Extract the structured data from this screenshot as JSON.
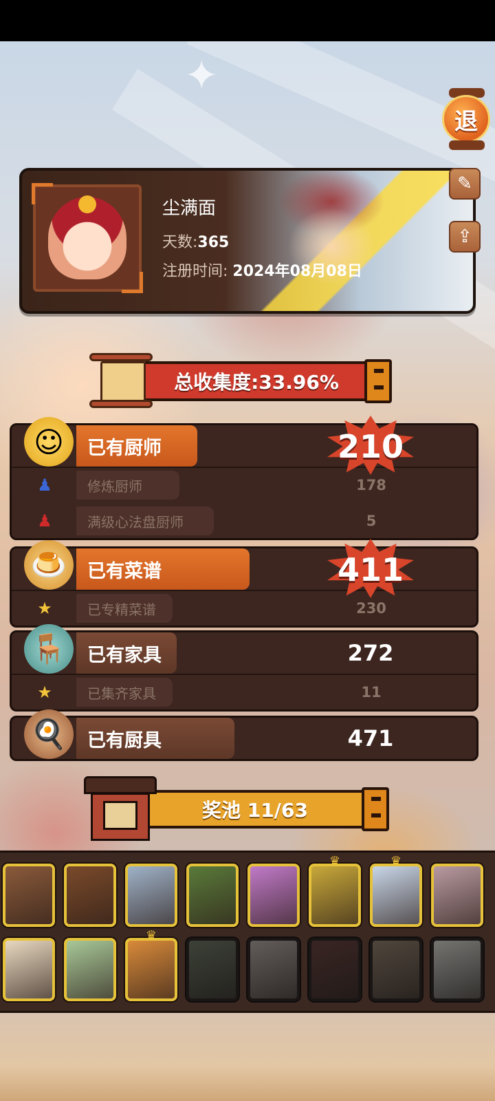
{
  "profile": {
    "name": "尘满面",
    "days_label": "天数:",
    "days_value": "365",
    "reg_label": "注册时间:",
    "reg_value": "2024年08月08日"
  },
  "buttons": {
    "exit": "退",
    "edit_icon": "edit-icon",
    "share_icon": "share-icon"
  },
  "collection": {
    "label": "总收集度:33.96%"
  },
  "stats": {
    "chefs": {
      "label": "已有厨师",
      "count": "210",
      "sub": [
        {
          "label": "修炼厨师",
          "count": "178",
          "icon": "blue-chef-icon"
        },
        {
          "label": "满级心法盘厨师",
          "count": "5",
          "icon": "red-chef-icon"
        }
      ]
    },
    "recipes": {
      "label": "已有菜谱",
      "count": "411",
      "sub": [
        {
          "label": "已专精菜谱",
          "count": "230",
          "icon": "star-icon"
        }
      ]
    },
    "furniture": {
      "label": "已有家具",
      "count": "272",
      "sub": [
        {
          "label": "已集齐家具",
          "count": "11",
          "icon": "star-icon"
        }
      ]
    },
    "utensils": {
      "label": "已有厨具",
      "count": "471"
    }
  },
  "prize_pool": {
    "label": "奖池   11/63",
    "cards": [
      {
        "unlocked": true,
        "crowned": false,
        "color": "#8a5a3a"
      },
      {
        "unlocked": true,
        "crowned": false,
        "color": "#7a4a2a"
      },
      {
        "unlocked": true,
        "crowned": false,
        "color": "#9fb2c8"
      },
      {
        "unlocked": true,
        "crowned": false,
        "color": "#5a7a3a"
      },
      {
        "unlocked": true,
        "crowned": false,
        "color": "#c07ac8"
      },
      {
        "unlocked": true,
        "crowned": true,
        "color": "#c8a83a"
      },
      {
        "unlocked": true,
        "crowned": true,
        "color": "#c8d6e8"
      },
      {
        "unlocked": true,
        "crowned": false,
        "color": "#b89aa0"
      },
      {
        "unlocked": true,
        "crowned": false,
        "color": "#e8d8c0"
      },
      {
        "unlocked": true,
        "crowned": false,
        "color": "#a8c898"
      },
      {
        "unlocked": true,
        "crowned": true,
        "color": "#d88a3a"
      },
      {
        "unlocked": false,
        "crowned": false,
        "color": "#4a5a3a"
      },
      {
        "unlocked": false,
        "crowned": false,
        "color": "#8a7a70"
      },
      {
        "unlocked": false,
        "crowned": false,
        "color": "#6a2a22"
      },
      {
        "unlocked": false,
        "crowned": false,
        "color": "#7a5a3a"
      },
      {
        "unlocked": false,
        "crowned": false,
        "color": "#9a9a90"
      }
    ]
  }
}
